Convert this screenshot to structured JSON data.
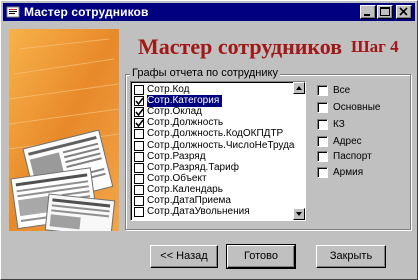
{
  "window": {
    "title": "Мастер сотрудников"
  },
  "header": {
    "title": "Мастер сотрудников",
    "step": "Шаг 4"
  },
  "fields_group": {
    "legend": "Графы отчета по сотруднику",
    "items": [
      {
        "label": "Сотр.Код",
        "checked": false,
        "selected": false
      },
      {
        "label": "Сотр.Категория",
        "checked": true,
        "selected": true
      },
      {
        "label": "Сотр.Оклад",
        "checked": true,
        "selected": false
      },
      {
        "label": "Сотр.Должность",
        "checked": true,
        "selected": false
      },
      {
        "label": "Сотр.Должность.КодОКПДТР",
        "checked": false,
        "selected": false
      },
      {
        "label": "Сотр.Должность.ЧислоНеТруда",
        "checked": false,
        "selected": false
      },
      {
        "label": "Сотр.Разряд",
        "checked": false,
        "selected": false
      },
      {
        "label": "Сотр.Разряд.Тариф",
        "checked": false,
        "selected": false
      },
      {
        "label": "Сотр.Объект",
        "checked": false,
        "selected": false
      },
      {
        "label": "Сотр.Календарь",
        "checked": false,
        "selected": false
      },
      {
        "label": "Сотр.ДатаПриема",
        "checked": false,
        "selected": false
      },
      {
        "label": "Сотр.ДатаУвольнения",
        "checked": false,
        "selected": false
      }
    ],
    "options": [
      {
        "label": "Все",
        "checked": false
      },
      {
        "label": "Основные",
        "checked": false
      },
      {
        "label": "КЗ",
        "checked": false
      },
      {
        "label": "Адрес",
        "checked": false
      },
      {
        "label": "Паспорт",
        "checked": false
      },
      {
        "label": "Армия",
        "checked": false
      }
    ]
  },
  "buttons": {
    "back": "<< Назад",
    "done": "Готово",
    "close": "Закрыть"
  },
  "colors": {
    "titlebar": "#000080",
    "accent": "#a01818",
    "face": "#c0c0c0"
  }
}
